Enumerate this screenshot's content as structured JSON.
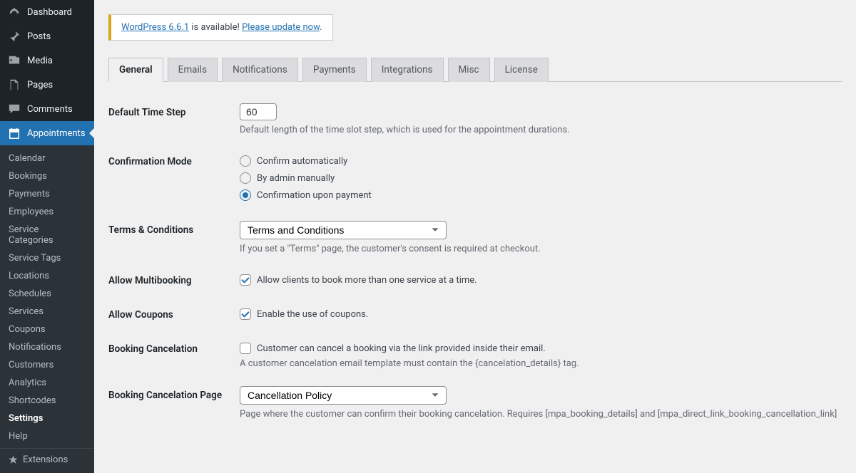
{
  "sidebar": {
    "top": [
      {
        "icon": "dashboard-icon",
        "label": "Dashboard"
      },
      {
        "icon": "pin-icon",
        "label": "Posts"
      },
      {
        "icon": "media-icon",
        "label": "Media"
      },
      {
        "icon": "page-icon",
        "label": "Pages"
      },
      {
        "icon": "comments-icon",
        "label": "Comments"
      },
      {
        "icon": "calendar-icon",
        "label": "Appointments",
        "active": true
      }
    ],
    "submenu": [
      "Calendar",
      "Bookings",
      "Payments",
      "Employees",
      "Service Categories",
      "Service Tags",
      "Locations",
      "Schedules",
      "Services",
      "Coupons",
      "Notifications",
      "Customers",
      "Analytics",
      "Shortcodes",
      "Settings",
      "Help"
    ],
    "submenu_current": "Settings",
    "extensions_label": "Extensions"
  },
  "notice": {
    "link1": "WordPress 6.6.1",
    "text": " is available! ",
    "link2": "Please update now"
  },
  "tabs": [
    "General",
    "Emails",
    "Notifications",
    "Payments",
    "Integrations",
    "Misc",
    "License"
  ],
  "tab_active": "General",
  "settings": {
    "time_step": {
      "label": "Default Time Step",
      "value": "60",
      "desc": "Default length of the time slot step, which is used for the appointment durations."
    },
    "confirmation": {
      "label": "Confirmation Mode",
      "options": [
        "Confirm automatically",
        "By admin manually",
        "Confirmation upon payment"
      ],
      "selected": 2
    },
    "terms": {
      "label": "Terms & Conditions",
      "selected": "Terms and Conditions",
      "desc": "If you set a \"Terms\" page, the customer's consent is required at checkout."
    },
    "multibooking": {
      "label": "Allow Multibooking",
      "checkbox_label": "Allow clients to book more than one service at a time.",
      "checked": true
    },
    "coupons": {
      "label": "Allow Coupons",
      "checkbox_label": "Enable the use of coupons.",
      "checked": true
    },
    "cancel": {
      "label": "Booking Cancelation",
      "checkbox_label": "Customer can cancel a booking via the link provided inside their email.",
      "checked": false,
      "desc": "A customer cancelation email template must contain the {cancelation_details} tag."
    },
    "cancel_page": {
      "label": "Booking Cancelation Page",
      "selected": "Cancellation Policy",
      "desc": "Page where the customer can confirm their booking cancelation. Requires [mpa_booking_details] and [mpa_direct_link_booking_cancellation_link] shortcodes."
    }
  }
}
